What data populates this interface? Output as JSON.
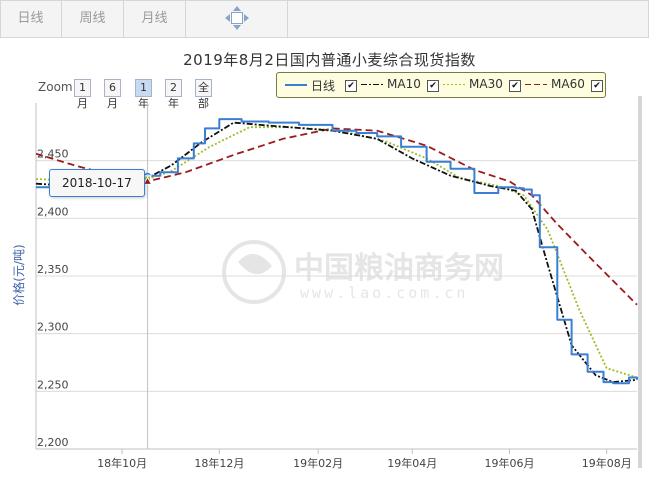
{
  "tabs": [
    {
      "label": "日线",
      "active": true
    },
    {
      "label": "周线",
      "active": false
    },
    {
      "label": "月线",
      "active": false
    }
  ],
  "chart_title": "2019年8月2日国内普通小麦综合现货指数",
  "zoom": {
    "label": "Zoom",
    "options": [
      "1月",
      "6月",
      "1年",
      "2年",
      "全部"
    ],
    "selected": "1年"
  },
  "legend": [
    {
      "name": "日线",
      "color": "#3a7fd4",
      "style": "solid",
      "checked": true
    },
    {
      "name": "MA10",
      "color": "#111111",
      "style": "dashdot",
      "checked": true
    },
    {
      "name": "MA30",
      "color": "#9dbd2b",
      "style": "dotted",
      "checked": true
    },
    {
      "name": "MA60",
      "color": "#9b1b1b",
      "style": "dashed",
      "checked": true
    }
  ],
  "extra_checkbox_checked": true,
  "tooltip": {
    "label": "2018-10-17"
  },
  "watermark": {
    "cn": "中国粮油商务网",
    "url": "www.lao.com.cn"
  },
  "chart_data": {
    "type": "line",
    "title": "2019年8月2日国内普通小麦综合现货指数",
    "ylabel": "价格(元/吨)",
    "xlabel": "",
    "ylim": [
      2200,
      2500
    ],
    "xlim": [
      "2018-08-08",
      "2019-08-20"
    ],
    "yticks": [
      2200,
      2250,
      2300,
      2350,
      2400,
      2450
    ],
    "ytick_labels": [
      "2,200",
      "2,250",
      "2,300",
      "2,350",
      "2,400",
      "2,450"
    ],
    "xticks": [
      "2018-10-01",
      "2018-12-01",
      "2019-02-01",
      "2019-04-01",
      "2019-06-01",
      "2019-08-01"
    ],
    "xtick_labels": [
      "18年10月",
      "18年12月",
      "19年02月",
      "19年04月",
      "19年06月",
      "19年08月"
    ],
    "grid": true,
    "legend_position": "top-right",
    "series": [
      {
        "name": "日线",
        "x": [
          "2018-08-08",
          "2018-09-01",
          "2018-09-20",
          "2018-10-05",
          "2018-10-17",
          "2018-10-25",
          "2018-11-05",
          "2018-11-15",
          "2018-11-22",
          "2018-12-01",
          "2018-12-15",
          "2019-01-01",
          "2019-01-20",
          "2019-02-10",
          "2019-02-25",
          "2019-03-10",
          "2019-03-25",
          "2019-04-10",
          "2019-04-25",
          "2019-05-10",
          "2019-05-25",
          "2019-06-05",
          "2019-06-10",
          "2019-06-15",
          "2019-06-20",
          "2019-07-01",
          "2019-07-10",
          "2019-07-20",
          "2019-07-30",
          "2019-08-05",
          "2019-08-15",
          "2019-08-20"
        ],
        "values": [
          2427,
          2424,
          2426,
          2430,
          2437,
          2440,
          2452,
          2465,
          2478,
          2486,
          2484,
          2483,
          2481,
          2476,
          2474,
          2471,
          2462,
          2449,
          2443,
          2422,
          2427,
          2426,
          2425,
          2420,
          2375,
          2312,
          2282,
          2267,
          2258,
          2257,
          2262,
          2260
        ]
      },
      {
        "name": "MA10",
        "x": [
          "2018-08-08",
          "2018-09-01",
          "2018-10-01",
          "2018-10-17",
          "2018-11-01",
          "2018-11-20",
          "2018-12-10",
          "2019-01-05",
          "2019-02-10",
          "2019-03-10",
          "2019-04-01",
          "2019-04-25",
          "2019-05-20",
          "2019-06-05",
          "2019-06-15",
          "2019-06-25",
          "2019-07-10",
          "2019-07-25",
          "2019-08-05",
          "2019-08-20"
        ],
        "values": [
          2430,
          2428,
          2430,
          2435,
          2446,
          2466,
          2483,
          2480,
          2476,
          2469,
          2452,
          2437,
          2428,
          2424,
          2408,
          2360,
          2290,
          2264,
          2258,
          2260
        ]
      },
      {
        "name": "MA30",
        "x": [
          "2018-08-08",
          "2018-09-01",
          "2018-10-01",
          "2018-10-17",
          "2018-11-01",
          "2018-11-25",
          "2018-12-20",
          "2019-01-15",
          "2019-02-15",
          "2019-03-15",
          "2019-04-10",
          "2019-05-01",
          "2019-05-25",
          "2019-06-10",
          "2019-06-25",
          "2019-07-15",
          "2019-08-01",
          "2019-08-20"
        ],
        "values": [
          2434,
          2433,
          2432,
          2434,
          2441,
          2462,
          2479,
          2479,
          2476,
          2467,
          2452,
          2435,
          2428,
          2420,
          2390,
          2320,
          2270,
          2262
        ]
      },
      {
        "name": "MA60",
        "x": [
          "2018-08-08",
          "2018-09-01",
          "2018-10-01",
          "2018-10-17",
          "2018-11-10",
          "2018-12-10",
          "2019-01-10",
          "2019-02-10",
          "2019-03-10",
          "2019-04-10",
          "2019-05-10",
          "2019-06-01",
          "2019-06-15",
          "2019-07-01",
          "2019-07-20",
          "2019-08-20"
        ],
        "values": [
          2456,
          2446,
          2435,
          2432,
          2440,
          2455,
          2469,
          2478,
          2476,
          2463,
          2442,
          2432,
          2420,
          2395,
          2368,
          2325
        ]
      }
    ]
  }
}
